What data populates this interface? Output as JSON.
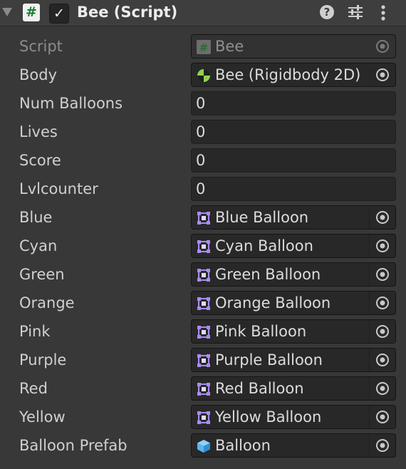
{
  "component": {
    "title": "Bee (Script)",
    "icon": "script-hash-icon",
    "enabled": true
  },
  "fields": [
    {
      "label": "Script",
      "type": "object",
      "value": "Bee",
      "icon": "script-hash-icon",
      "disabled": true
    },
    {
      "label": "Body",
      "type": "object",
      "value": "Bee (Rigidbody 2D)",
      "icon": "rigidbody2d-icon"
    },
    {
      "label": "Num Balloons",
      "type": "number",
      "value": "0"
    },
    {
      "label": "Lives",
      "type": "number",
      "value": "0"
    },
    {
      "label": "Score",
      "type": "number",
      "value": "0"
    },
    {
      "label": "Lvlcounter",
      "type": "number",
      "value": "0"
    },
    {
      "label": "Blue",
      "type": "object",
      "value": "Blue Balloon",
      "icon": "sprite-icon"
    },
    {
      "label": "Cyan",
      "type": "object",
      "value": "Cyan Balloon",
      "icon": "sprite-icon"
    },
    {
      "label": "Green",
      "type": "object",
      "value": "Green Balloon",
      "icon": "sprite-icon"
    },
    {
      "label": "Orange",
      "type": "object",
      "value": "Orange Balloon",
      "icon": "sprite-icon"
    },
    {
      "label": "Pink",
      "type": "object",
      "value": "Pink Balloon",
      "icon": "sprite-icon"
    },
    {
      "label": "Purple",
      "type": "object",
      "value": "Purple Balloon",
      "icon": "sprite-icon"
    },
    {
      "label": "Red",
      "type": "object",
      "value": "Red Balloon",
      "icon": "sprite-icon"
    },
    {
      "label": "Yellow",
      "type": "object",
      "value": "Yellow Balloon",
      "icon": "sprite-icon"
    },
    {
      "label": "Balloon Prefab",
      "type": "object",
      "value": "Balloon",
      "icon": "prefab-cube-icon"
    }
  ],
  "colors": {
    "panel": "#383838",
    "field": "#282828",
    "sprite_icon": "#a98cf0",
    "prefab_icon": "#5ab4f0",
    "script_hash": "#1e7a2e"
  }
}
